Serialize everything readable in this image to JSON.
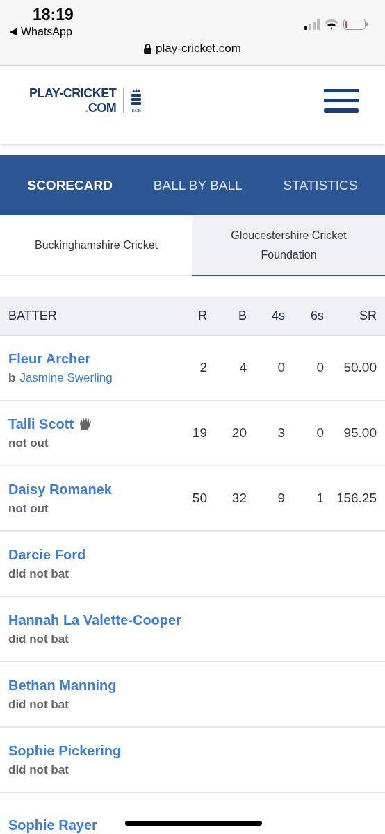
{
  "status_bar": {
    "time": "18:19",
    "back_label": "WhatsApp",
    "url": "play-cricket.com"
  },
  "header": {
    "logo_lines": [
      "PLAY-CRICKET",
      ".COM"
    ],
    "crest_label": "ECB"
  },
  "nav_tabs": [
    {
      "label": "SCORECARD",
      "selected": true
    },
    {
      "label": "BALL BY BALL",
      "selected": false
    },
    {
      "label": "STATISTICS",
      "selected": false
    }
  ],
  "team_tabs": [
    {
      "label": "Buckinghamshire Cricket",
      "selected": false
    },
    {
      "label": "Gloucestershire Cricket Foundation",
      "selected": true
    }
  ],
  "table": {
    "columns": [
      "BATTER",
      "R",
      "B",
      "4s",
      "6s",
      "SR"
    ],
    "rows": [
      {
        "name": "Fleur Archer",
        "keeper": false,
        "dismissal": {
          "kind": "bowled",
          "prefix": "b",
          "bowler": "Jasmine Swerling"
        },
        "stats": [
          "2",
          "4",
          "0",
          "0",
          "50.00"
        ]
      },
      {
        "name": "Talli Scott",
        "keeper": true,
        "dismissal": {
          "kind": "text",
          "text": "not out"
        },
        "stats": [
          "19",
          "20",
          "3",
          "0",
          "95.00"
        ]
      },
      {
        "name": "Daisy Romanek",
        "keeper": false,
        "dismissal": {
          "kind": "text",
          "text": "not out"
        },
        "stats": [
          "50",
          "32",
          "9",
          "1",
          "156.25"
        ]
      },
      {
        "name": "Darcie Ford",
        "keeper": false,
        "dismissal": {
          "kind": "text",
          "text": "did not bat"
        }
      },
      {
        "name": "Hannah La Valette-Cooper",
        "keeper": false,
        "dismissal": {
          "kind": "text",
          "text": "did not bat"
        }
      },
      {
        "name": "Bethan Manning",
        "keeper": false,
        "dismissal": {
          "kind": "text",
          "text": "did not bat"
        }
      },
      {
        "name": "Sophie Pickering",
        "keeper": false,
        "dismissal": {
          "kind": "text",
          "text": "did not bat"
        }
      },
      {
        "name": "Sophie Rayer",
        "keeper": false
      }
    ]
  }
}
